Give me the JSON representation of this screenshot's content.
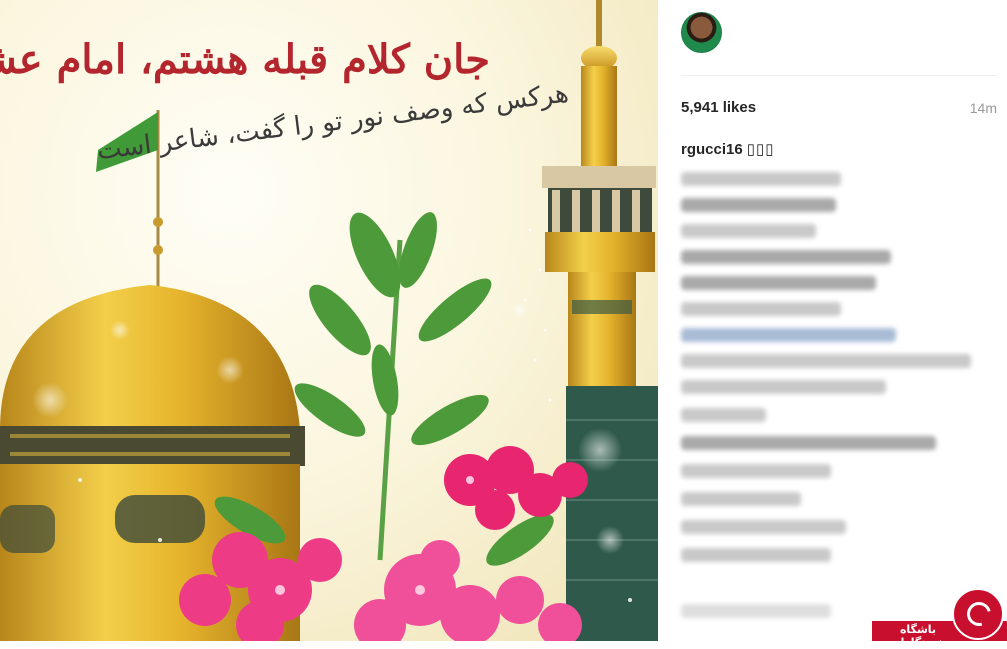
{
  "post": {
    "image": {
      "title_line": "جان کلام قبله هشتم، امام عشق",
      "sub_line": "هرکس که وصف نور تو را گفت، شاعر است"
    },
    "author": {
      "username": "rgucci16",
      "avatar_icon": "profile-avatar"
    },
    "likes": "5,941 likes",
    "time_ago": "14m",
    "caption_text": "▯▯▯"
  },
  "watermark": {
    "text": "باشگاه خبرنگاران",
    "brand_color": "#c8102e"
  },
  "colors": {
    "title_red": "#b4262d",
    "dome_gold": "#e2b52a",
    "flag_green": "#3f9a37",
    "flower_pink": "#e8256f"
  }
}
